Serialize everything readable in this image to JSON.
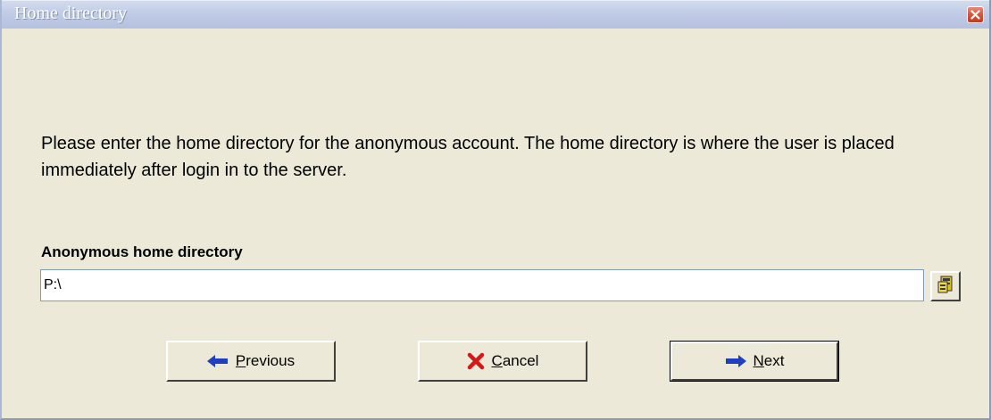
{
  "window": {
    "title": "Home directory"
  },
  "content": {
    "description": "Please enter the home directory for the anonymous account. The home directory is where the user is placed immediately after login in to the server.",
    "field_label": "Anonymous home directory",
    "home_directory_value": "P:\\"
  },
  "buttons": {
    "previous": {
      "accel": "P",
      "rest": "revious",
      "icon": "arrow-left-icon"
    },
    "cancel": {
      "accel": "C",
      "rest": "ancel",
      "icon": "red-x-icon"
    },
    "next": {
      "accel": "N",
      "rest": "ext",
      "icon": "arrow-right-icon"
    },
    "browse_icon": "folder-browse-icon",
    "close_icon": "close-icon"
  },
  "colors": {
    "dialog_background": "#ece9d8",
    "titlebar": "#c2cde6",
    "arrow_blue": "#1f3fbf",
    "cancel_red": "#d21a1a"
  }
}
